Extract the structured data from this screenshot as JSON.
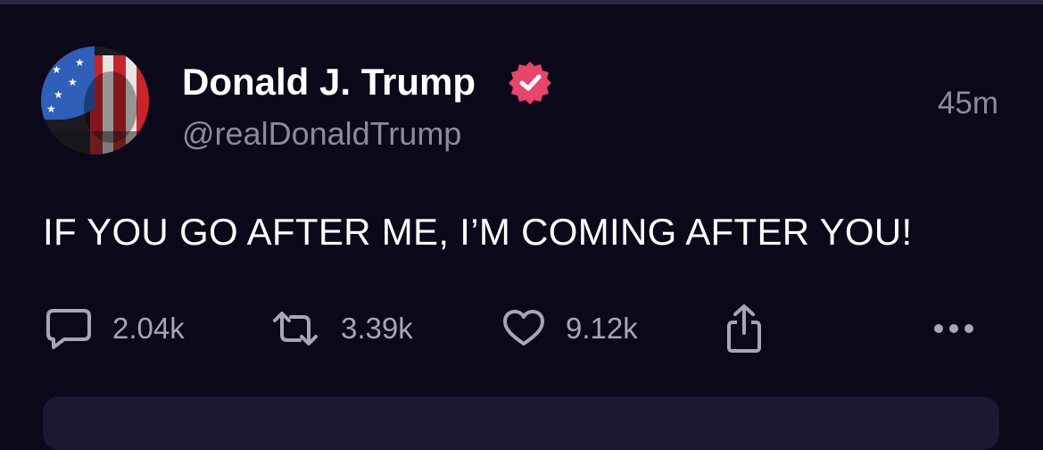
{
  "post": {
    "display_name": "Donald J. Trump",
    "handle": "@realDonaldTrump",
    "timestamp": "45m",
    "text": "IF YOU GO AFTER ME, I’M COMING AFTER YOU!",
    "verified": true
  },
  "actions": {
    "replies": "2.04k",
    "reposts": "3.39k",
    "likes": "9.12k"
  },
  "icons": {
    "reply": "speech-bubble-icon",
    "repost": "repost-arrows-icon",
    "like": "heart-icon",
    "share": "share-icon",
    "more": "more-dots-icon",
    "verified": "verified-badge-icon"
  },
  "colors": {
    "background": "#0b0819",
    "text_primary": "#ffffff",
    "text_secondary": "#8e8a9c",
    "verified_badge": "#e8456b",
    "card": "#1b1833"
  }
}
